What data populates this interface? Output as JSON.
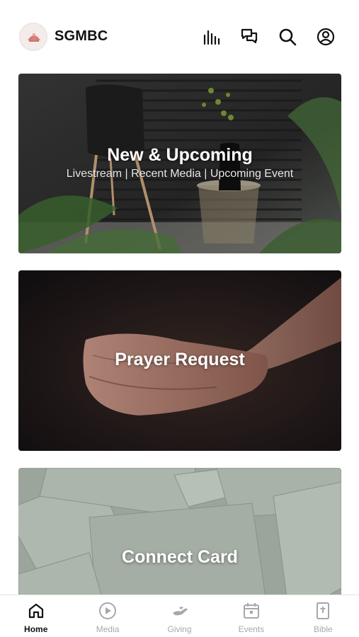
{
  "header": {
    "title": "SGMBC",
    "icons": [
      "audio-bars-icon",
      "chat-bubbles-icon",
      "search-icon",
      "profile-icon"
    ]
  },
  "cards": [
    {
      "title": "New & Upcoming",
      "subtitle": "Livestream | Recent Media | Upcoming Event"
    },
    {
      "title": "Prayer Request"
    },
    {
      "title": "Connect Card"
    }
  ],
  "tabs": [
    {
      "label": "Home",
      "icon": "home-icon",
      "active": true
    },
    {
      "label": "Media",
      "icon": "play-circle-icon",
      "active": false
    },
    {
      "label": "Giving",
      "icon": "giving-hand-icon",
      "active": false
    },
    {
      "label": "Events",
      "icon": "calendar-icon",
      "active": false
    },
    {
      "label": "Bible",
      "icon": "bible-icon",
      "active": false
    }
  ],
  "colors": {
    "active_tab": "#111111",
    "inactive_tab": "#a8a8a8",
    "card_text": "#ffffff"
  }
}
